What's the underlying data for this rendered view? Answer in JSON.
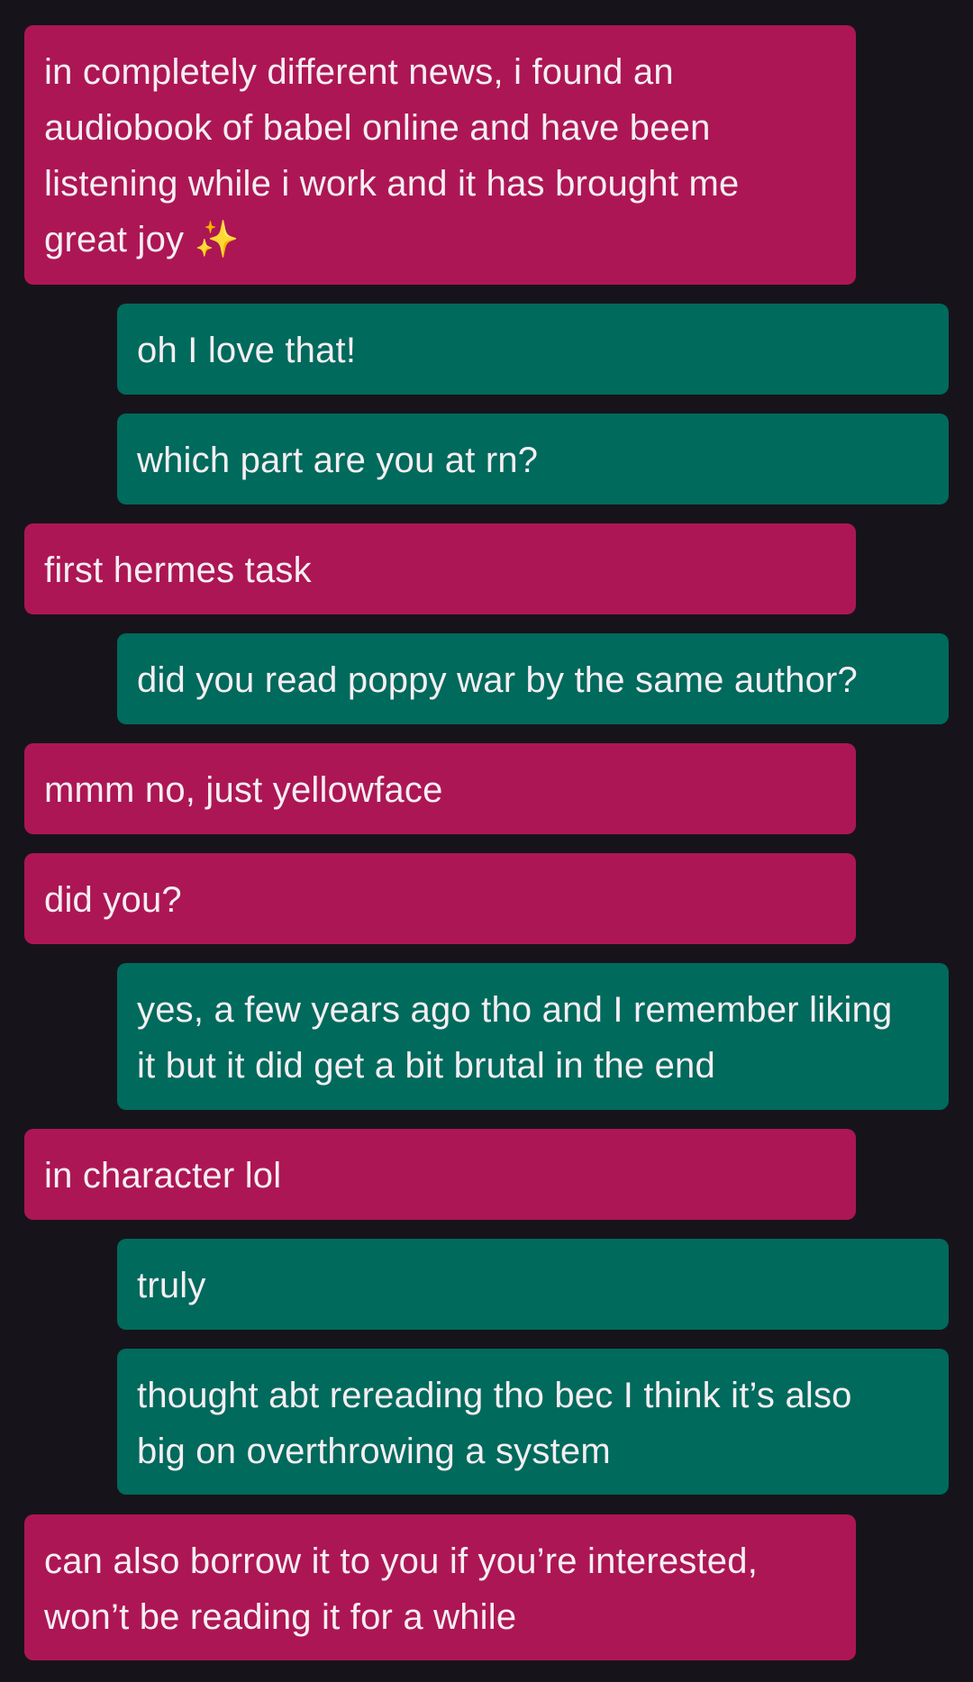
{
  "messages": [
    {
      "sender": "them",
      "text": "in completely different news, i found an\naudiobook of babel online and have been\nlistening while i work and it has brought me\ngreat joy ✨"
    },
    {
      "sender": "me",
      "text": "oh I love that!"
    },
    {
      "sender": "me",
      "text": "which part are you at rn?"
    },
    {
      "sender": "them",
      "text": "first hermes task"
    },
    {
      "sender": "me",
      "text": "did you read poppy war by the same author?"
    },
    {
      "sender": "them",
      "text": "mmm no, just yellowface"
    },
    {
      "sender": "them",
      "text": "did you?"
    },
    {
      "sender": "me",
      "text": "yes, a few years ago tho and I remember liking\nit but it did get a bit brutal in the end"
    },
    {
      "sender": "them",
      "text": "in character lol"
    },
    {
      "sender": "me",
      "text": "truly"
    },
    {
      "sender": "me",
      "text": "thought abt rereading tho bec I think it’s also\nbig on overthrowing a system"
    },
    {
      "sender": "them",
      "text": "can also borrow it to you if you’re interested,\nwon’t be reading it for a while"
    }
  ],
  "colors": {
    "background": "#16141a",
    "them_bubble": "#ad1654",
    "me_bubble": "#006a5c",
    "text": "#f4eef2"
  }
}
